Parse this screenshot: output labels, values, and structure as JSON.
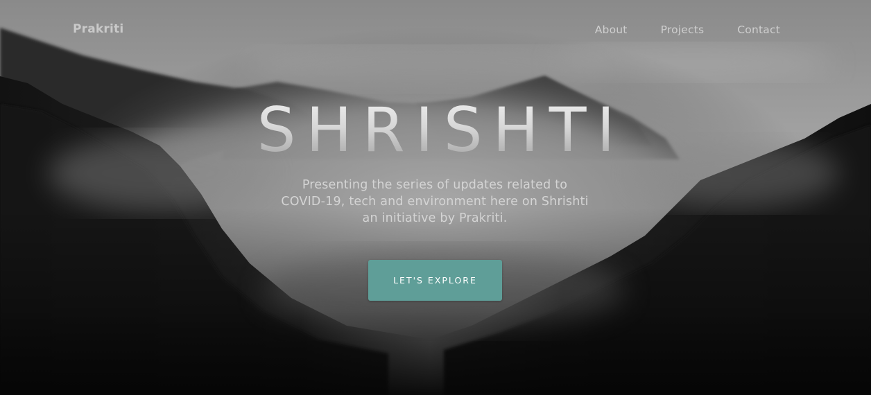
{
  "navbar": {
    "brand": "Prakriti",
    "links": [
      {
        "label": "About"
      },
      {
        "label": "Projects"
      },
      {
        "label": "Contact"
      }
    ]
  },
  "hero": {
    "title": "SHRISHTI",
    "subtitle": "Presenting the series of updates related to COVID-19, tech and environment here on Shrishti an initiative by Prakriti.",
    "cta_label": "LET'S EXPLORE"
  },
  "colors": {
    "accent": "#5f9e98",
    "nav_text": "#cfcfcf"
  },
  "background": {
    "icon": "misty-mountain-forest-photo"
  }
}
